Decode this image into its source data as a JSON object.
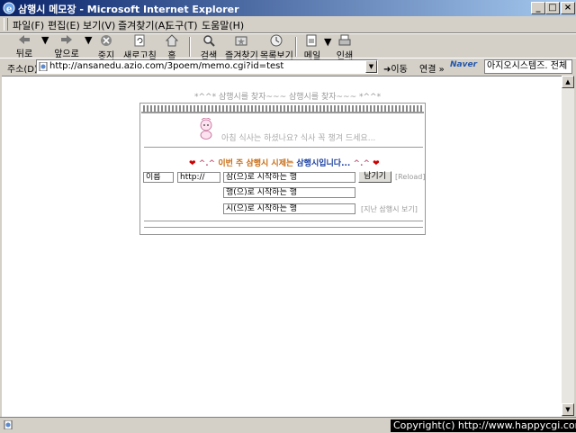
{
  "window": {
    "title": "삼행시 메모장 - Microsoft Internet Explorer",
    "minimize": "_",
    "maximize": "□",
    "close": "×"
  },
  "menu": [
    "파일(F)",
    "편집(E)",
    "보기(V)",
    "즐겨찾기(A)",
    "도구(T)",
    "도움말(H)"
  ],
  "toolbar": {
    "back": "뒤로",
    "forward": "앞으로",
    "stop": "중지",
    "refresh": "새로고침",
    "home": "홈",
    "search": "검색",
    "favorites": "즐겨찾기",
    "history": "목록보기",
    "mail": "메일",
    "print": "인쇄"
  },
  "address": {
    "label": "주소(D)",
    "url": "http://ansanedu.azio.com/3poem/memo.cgi?id=test",
    "go": "이동",
    "links": "연결 »",
    "naver": "Naver",
    "search_text": "아지오시스템즈. 전체"
  },
  "page": {
    "header": "*^^* 삼행시를 찾자~~~ 삼행시를 찾자~~~ *^^*",
    "intro": "아침 식사는 하셨나요? 식사 꼭 챙겨 드세요...",
    "topic": {
      "heart": "❤",
      "lead": "^.^",
      "mid": "이번 주 삼행시 시제는",
      "keyword": "삼행시입니다...",
      "tail": "^.^"
    },
    "form": {
      "name": "이름",
      "homepage": "http://",
      "line1": "삼(으)로 시작하는 행",
      "line2": "행(으)로 시작하는 행",
      "line3": "시(으)로 시작하는 행",
      "submit": "남기기",
      "reload": "[Reload]",
      "archive": "[지난 삼행시 보기]"
    }
  },
  "copyright": "Copyright(c) http://www.happycgi.com",
  "colors": {
    "titlebar": "#0a246a",
    "chrome": "#d4d0c8",
    "topic_keyword": "#1a3fa0",
    "topic_mid": "#c86a10",
    "heart": "#cc0000"
  }
}
